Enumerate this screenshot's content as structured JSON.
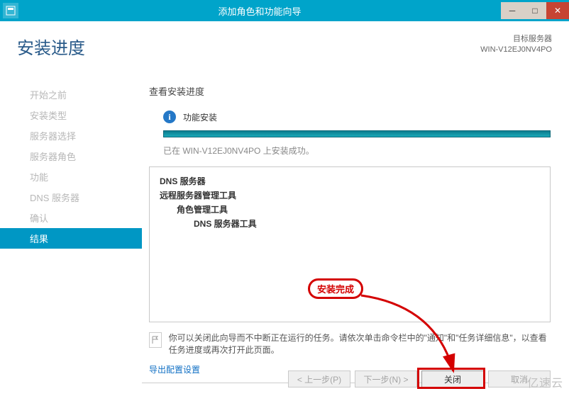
{
  "titlebar": {
    "title": "添加角色和功能向导"
  },
  "header": {
    "page_title": "安装进度",
    "target_label": "目标服务器",
    "target_value": "WIN-V12EJ0NV4PO"
  },
  "sidebar": {
    "items": [
      {
        "label": "开始之前"
      },
      {
        "label": "安装类型"
      },
      {
        "label": "服务器选择"
      },
      {
        "label": "服务器角色"
      },
      {
        "label": "功能"
      },
      {
        "label": "DNS 服务器"
      },
      {
        "label": "确认"
      },
      {
        "label": "结果"
      }
    ],
    "active_index": 7
  },
  "main": {
    "subtitle": "查看安装进度",
    "status_text": "功能安装",
    "success_msg": "已在 WIN-V12EJ0NV4PO 上安装成功。",
    "detail": {
      "line1": "DNS 服务器",
      "line2": "远程服务器管理工具",
      "line3": "角色管理工具",
      "line4": "DNS 服务器工具"
    },
    "note_text": "你可以关闭此向导而不中断正在运行的任务。请依次单击命令栏中的\"通知\"和\"任务详细信息\"，以查看任务进度或再次打开此页面。",
    "export_link": "导出配置设置"
  },
  "buttons": {
    "prev": "< 上一步(P)",
    "next": "下一步(N) >",
    "close": "关闭",
    "cancel": "取消"
  },
  "annotation": {
    "complete": "安装完成"
  },
  "watermark": "亿速云"
}
